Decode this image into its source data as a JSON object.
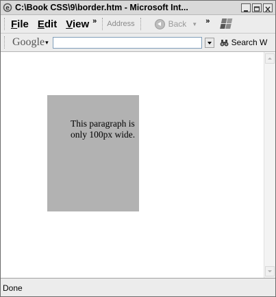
{
  "window": {
    "title": "C:\\Book CSS\\9\\border.htm - Microsoft Int",
    "title_overflow": "..."
  },
  "menubar": {
    "items": [
      {
        "first": "F",
        "rest": "ile"
      },
      {
        "first": "E",
        "rest": "dit"
      },
      {
        "first": "V",
        "rest": "iew"
      }
    ],
    "overflow": "»",
    "address_label": "Address",
    "back_label": "Back",
    "back_dropdown": "▼",
    "overflow2": "»"
  },
  "google_toolbar": {
    "logo": "Google",
    "logo_caret": "▾",
    "search_value": "",
    "search_label": "Search W"
  },
  "content": {
    "paragraph": "This paragraph is only 100px wide."
  },
  "status": {
    "text": "Done"
  },
  "icons": {
    "ie": "ie-icon",
    "windows": "windows-logo",
    "search": "binoculars-icon"
  }
}
